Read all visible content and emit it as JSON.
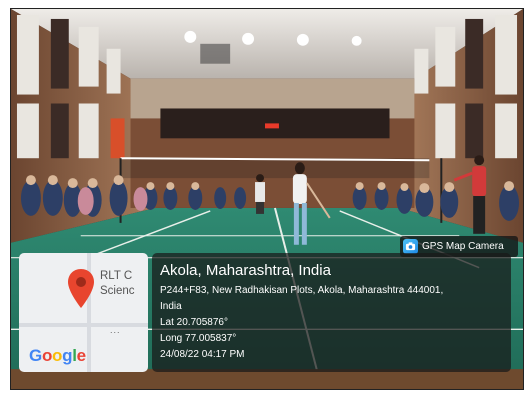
{
  "overlay": {
    "camera_badge": "GPS Map Camera",
    "map": {
      "poi_label_line1": "RLT C",
      "poi_label_line2": "Scienc",
      "dots": "...",
      "logo_letters": [
        "G",
        "o",
        "o",
        "g",
        "l",
        "e"
      ],
      "logo_colors": [
        "#4285F4",
        "#EA4335",
        "#FBBC05",
        "#4285F4",
        "#34A853",
        "#EA4335"
      ]
    },
    "location": {
      "title": "Akola, Maharashtra, India",
      "address_line1": "P244+F83, New Radhakisan Plots, Akola, Maharashtra 444001,",
      "address_line2": "India",
      "latitude": "Lat 20.705876°",
      "longitude": "Long 77.005837°",
      "timestamp": "24/08/22 04:17 PM"
    }
  },
  "icons": [
    "map-pin-icon",
    "camera-icon"
  ],
  "colors": {
    "court": "#2c7f68",
    "wall": "#8a5a3c",
    "ceiling": "#d8d4cf",
    "pin": "#e8452e"
  }
}
